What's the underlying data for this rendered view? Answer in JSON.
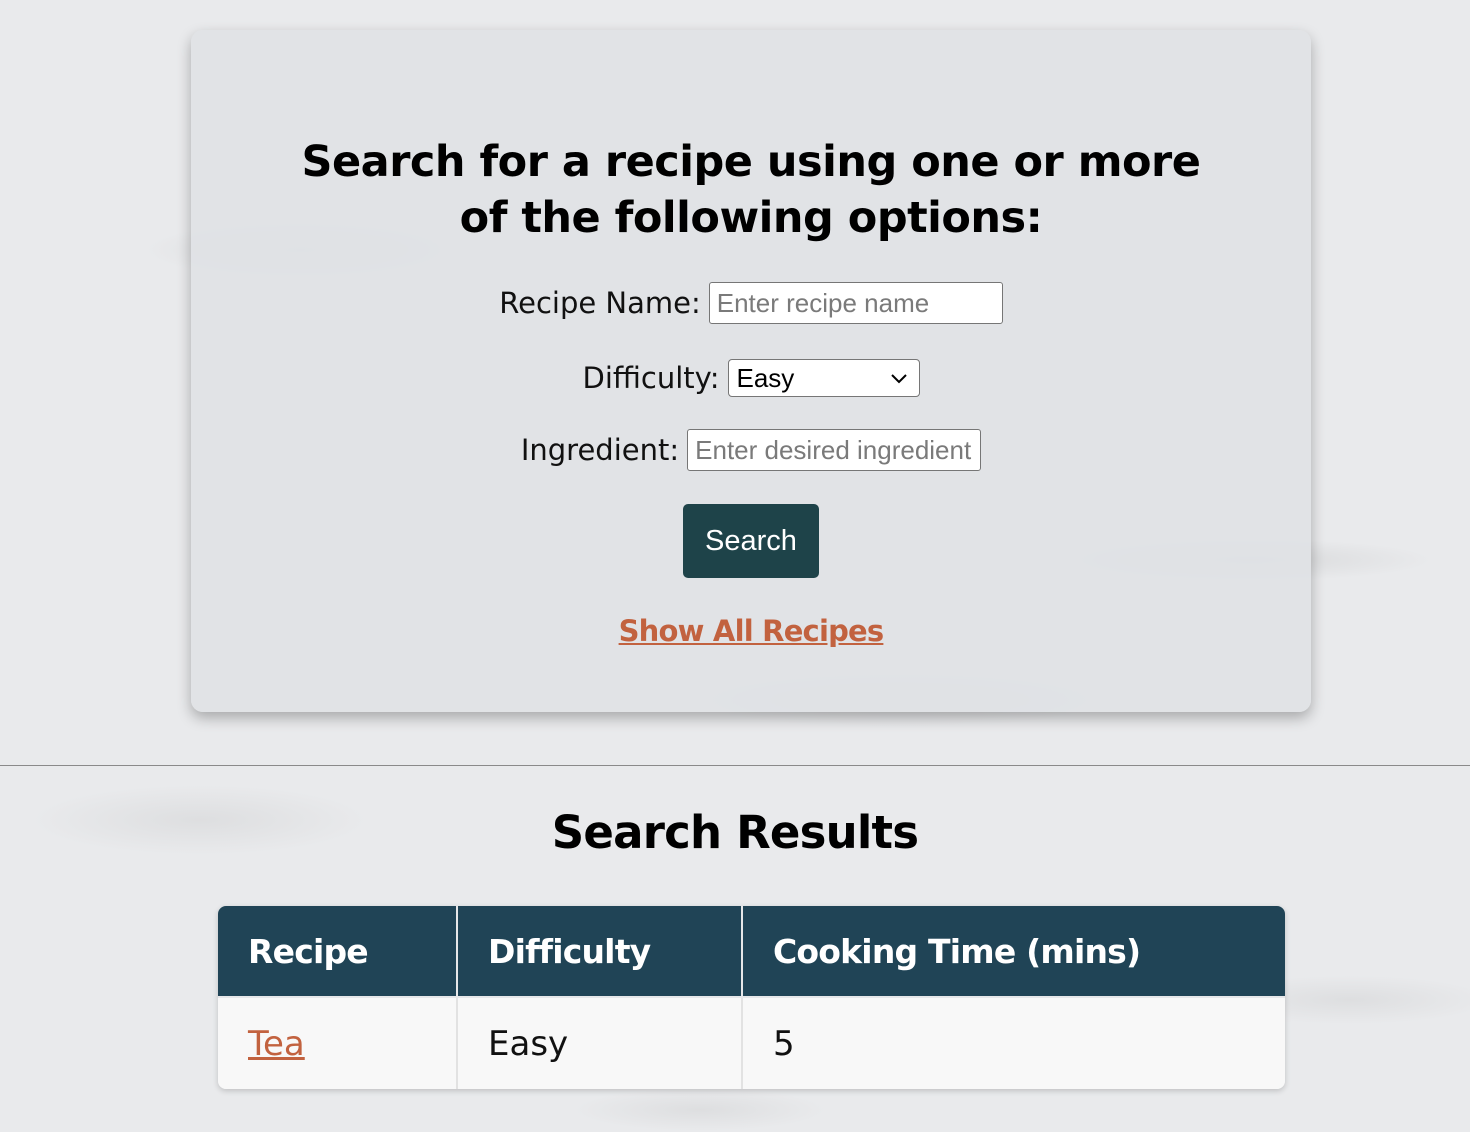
{
  "search_form": {
    "title": "Search for a recipe using one or more of the following options:",
    "recipe_name_label": "Recipe Name:",
    "recipe_name_placeholder": "Enter recipe name",
    "difficulty_label": "Difficulty:",
    "difficulty_selected": "Easy",
    "ingredient_label": "Ingredient:",
    "ingredient_placeholder": "Enter desired ingredient",
    "search_button_label": "Search",
    "show_all_link": "Show All Recipes"
  },
  "results": {
    "title": "Search Results",
    "columns": [
      "Recipe",
      "Difficulty",
      "Cooking Time (mins)"
    ],
    "rows": [
      {
        "recipe": "Tea",
        "difficulty": "Easy",
        "cooking_time": "5"
      }
    ]
  },
  "colors": {
    "accent_dark": "#1e4349",
    "table_header": "#204456",
    "link": "#c2623f"
  },
  "icons": {
    "select_arrow": "chevron-down-icon"
  }
}
